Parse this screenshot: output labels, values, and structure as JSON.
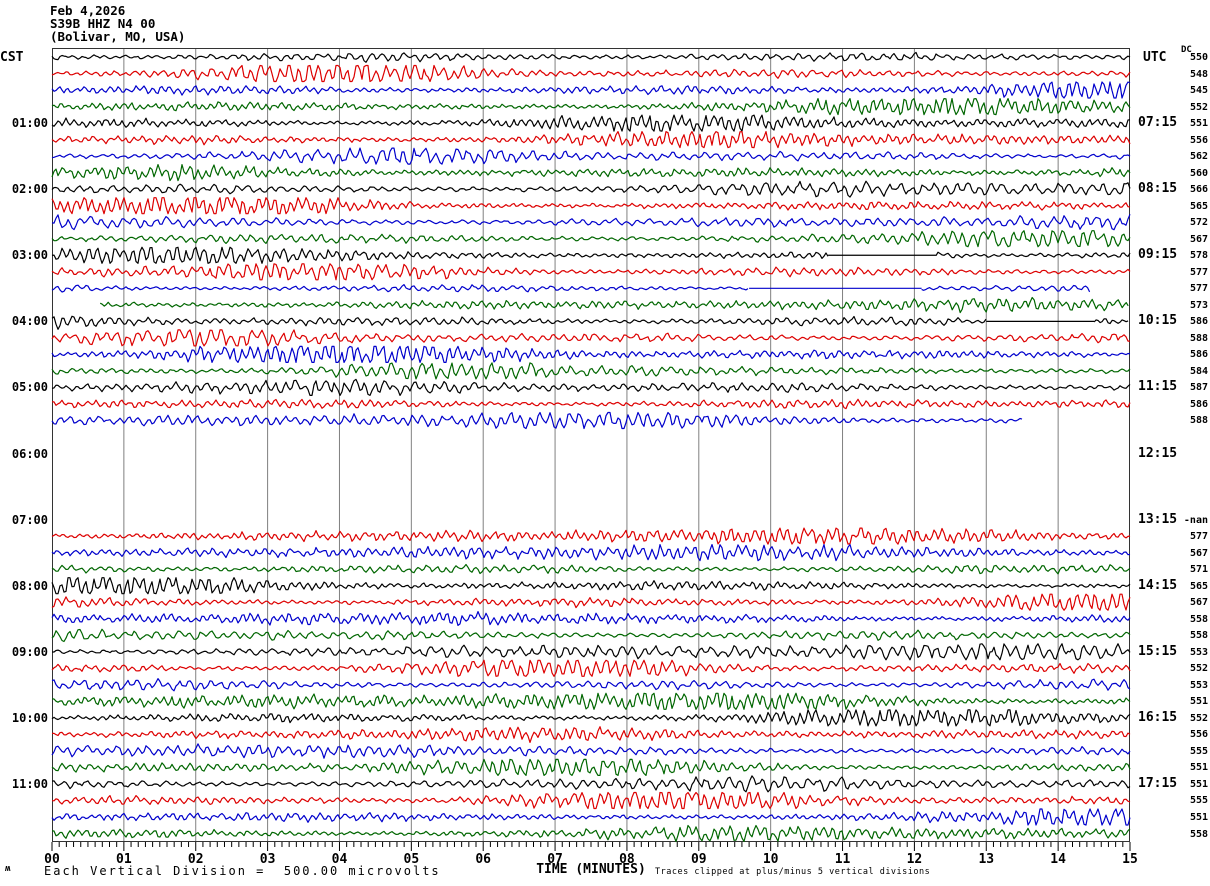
{
  "header": {
    "date": "Feb 4,2026",
    "station": "S39B HHZ N4 00",
    "location": "(Bolivar, MO, USA)",
    "left_timezone": "CST",
    "right_timezone": "UTC",
    "dc_column_header": "DC"
  },
  "footer": {
    "division_note": "Each Vertical Division =  500.00 microvolts",
    "time_axis_label": "TIME (MINUTES)",
    "clip_note": "Traces clipped at plus/minus 5 vertical divisions",
    "logo_glyph": "ʍ"
  },
  "colors": {
    "black": "#000000",
    "red": "#dd0000",
    "blue": "#0000cc",
    "green": "#006600",
    "grid": "#808080",
    "border": "#333333"
  },
  "chart_data": {
    "type": "line",
    "description": "Helicorder seismogram: 48 rows of 15-minute traces, colors cycling black/red/blue/green. Left labels = CST row start hour, right labels = UTC row end time, far right = DC offset per row.",
    "x_axis": {
      "label": "TIME (MINUTES)",
      "ticks": [
        "00",
        "01",
        "02",
        "03",
        "04",
        "05",
        "06",
        "07",
        "08",
        "09",
        "10",
        "11",
        "12",
        "13",
        "14",
        "15"
      ],
      "minutes_per_row": 15,
      "minor_ticks_per_minute": 10,
      "grid": "vertical line at each minute"
    },
    "hour_labels_cst": [
      "01:00",
      "02:00",
      "03:00",
      "04:00",
      "05:00",
      "06:00",
      "07:00",
      "08:00",
      "09:00",
      "10:00",
      "11:00"
    ],
    "hour_labels_utc": [
      "07:15",
      "08:15",
      "09:15",
      "10:15",
      "11:15",
      "12:15",
      "13:15",
      "14:15",
      "15:15",
      "16:15",
      "17:15"
    ],
    "rows": [
      {
        "color": "black",
        "dc": "550"
      },
      {
        "color": "red",
        "dc": "548"
      },
      {
        "color": "blue",
        "dc": "545"
      },
      {
        "color": "green",
        "dc": "552"
      },
      {
        "color": "black",
        "dc": "551"
      },
      {
        "color": "red",
        "dc": "556"
      },
      {
        "color": "blue",
        "dc": "562"
      },
      {
        "color": "green",
        "dc": "560"
      },
      {
        "color": "black",
        "dc": "566"
      },
      {
        "color": "red",
        "dc": "565"
      },
      {
        "color": "blue",
        "dc": "572"
      },
      {
        "color": "green",
        "dc": "567"
      },
      {
        "color": "black",
        "dc": "578",
        "segments": [
          {
            "from": 0,
            "to": 10.8,
            "kind": "wiggle"
          },
          {
            "from": 10.8,
            "to": 12.3,
            "kind": "flat"
          },
          {
            "from": 12.3,
            "to": 15,
            "kind": "wiggle"
          }
        ]
      },
      {
        "color": "red",
        "dc": "577"
      },
      {
        "color": "blue",
        "dc": "577",
        "segments": [
          {
            "from": 0,
            "to": 9.7,
            "kind": "wiggle",
            "amp": 0.8
          },
          {
            "from": 9.7,
            "to": 12.1,
            "kind": "flat"
          },
          {
            "from": 12.1,
            "to": 14.45,
            "kind": "wiggle",
            "amp": 0.9
          }
        ]
      },
      {
        "color": "green",
        "dc": "573",
        "segments": [
          {
            "from": 0.67,
            "to": 15,
            "kind": "wiggle"
          }
        ]
      },
      {
        "color": "black",
        "dc": "586",
        "segments": [
          {
            "from": 0,
            "to": 13.0,
            "kind": "wiggle"
          },
          {
            "from": 13.0,
            "to": 14.5,
            "kind": "flat"
          },
          {
            "from": 14.5,
            "to": 15,
            "kind": "wiggle"
          }
        ]
      },
      {
        "color": "red",
        "dc": "588"
      },
      {
        "color": "blue",
        "dc": "586"
      },
      {
        "color": "green",
        "dc": "584"
      },
      {
        "color": "black",
        "dc": "587"
      },
      {
        "color": "red",
        "dc": "586"
      },
      {
        "color": "blue",
        "dc": "588",
        "segments": [
          {
            "from": 0,
            "to": 13.5,
            "kind": "wiggle"
          }
        ]
      },
      {
        "color": "green",
        "absent": true
      },
      {
        "color": "black",
        "absent": true
      },
      {
        "color": "red",
        "absent": true
      },
      {
        "color": "blue",
        "absent": true
      },
      {
        "color": "green",
        "absent": true
      },
      {
        "color": "black",
        "absent": true,
        "dc": "-nan"
      },
      {
        "color": "red",
        "dc": "577"
      },
      {
        "color": "blue",
        "dc": "567"
      },
      {
        "color": "green",
        "dc": "571"
      },
      {
        "color": "black",
        "dc": "565"
      },
      {
        "color": "red",
        "dc": "567"
      },
      {
        "color": "blue",
        "dc": "558"
      },
      {
        "color": "green",
        "dc": "558"
      },
      {
        "color": "black",
        "dc": "553"
      },
      {
        "color": "red",
        "dc": "552"
      },
      {
        "color": "blue",
        "dc": "553"
      },
      {
        "color": "green",
        "dc": "551"
      },
      {
        "color": "black",
        "dc": "552"
      },
      {
        "color": "red",
        "dc": "556"
      },
      {
        "color": "blue",
        "dc": "555"
      },
      {
        "color": "green",
        "dc": "551"
      },
      {
        "color": "black",
        "dc": "551"
      },
      {
        "color": "red",
        "dc": "555"
      },
      {
        "color": "blue",
        "dc": "551"
      },
      {
        "color": "green",
        "dc": "558"
      }
    ]
  }
}
